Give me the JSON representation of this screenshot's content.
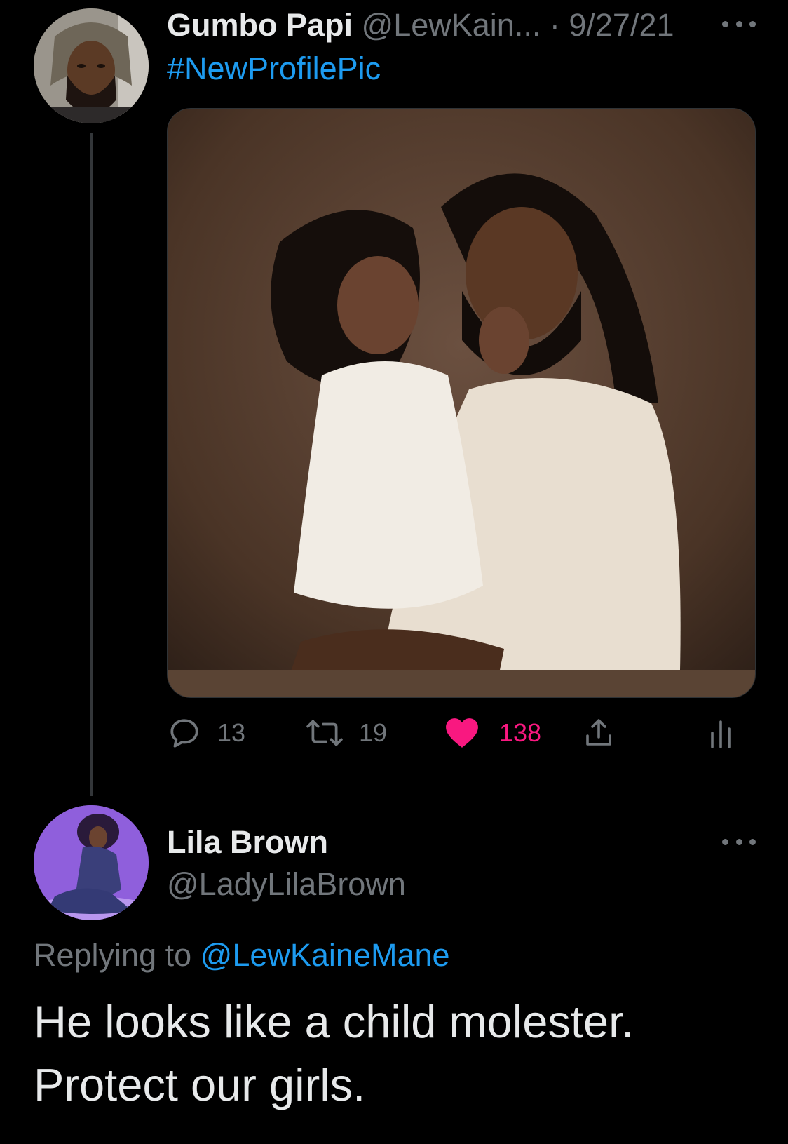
{
  "original_tweet": {
    "display_name": "Gumbo Papi",
    "handle": "@LewKain...",
    "separator": "·",
    "date": "9/27/21",
    "text": "#NewProfilePic",
    "stats": {
      "replies": "13",
      "retweets": "19",
      "likes": "138"
    }
  },
  "reply_tweet": {
    "display_name": "Lila Brown",
    "handle": "@LadyLilaBrown",
    "replying_to_prefix": "Replying to",
    "replying_to_handle": "@LewKaineMane",
    "text_line1": "He looks like a child molester.",
    "text_line2": "Protect our girls."
  },
  "icons": {
    "reply": "reply-icon",
    "retweet": "retweet-icon",
    "like": "heart-icon",
    "share": "share-icon",
    "analytics": "analytics-icon",
    "more": "more-icon"
  },
  "colors": {
    "background": "#000000",
    "text_primary": "#e7e9ea",
    "text_secondary": "#71767b",
    "link": "#1d9bf0",
    "like_active": "#f91880"
  }
}
